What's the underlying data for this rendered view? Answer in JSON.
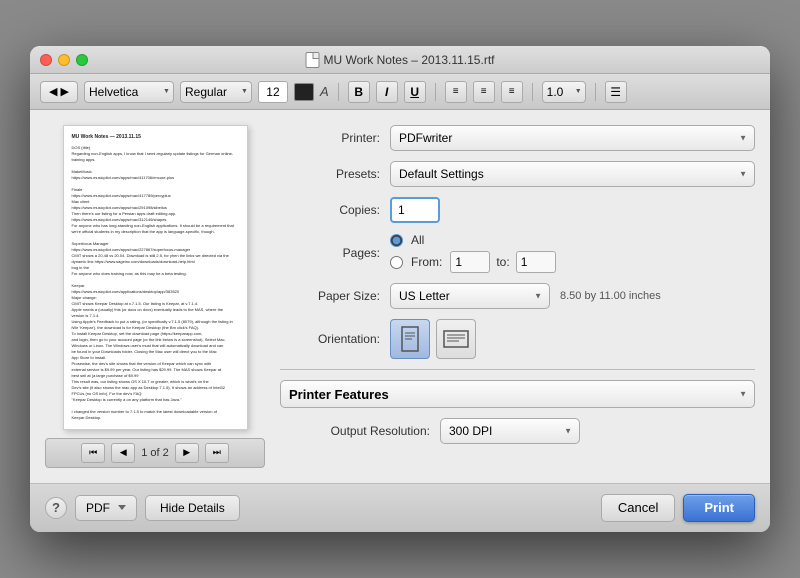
{
  "titlebar": {
    "title": "MU Work Notes – 2013.11.15.rtf"
  },
  "toolbar": {
    "format_btn_label": "▶|◀",
    "font_label": "Helvetica",
    "style_label": "Regular",
    "size_value": "12",
    "bold_label": "B",
    "italic_label": "I",
    "underline_label": "U",
    "align_left": "≡",
    "align_center": "≡",
    "align_right": "≡",
    "line_height": "1.0",
    "list_icon": "≡"
  },
  "printer": {
    "label": "Printer:",
    "value": "PDFwriter",
    "presets_label": "Presets:",
    "presets_value": "Default Settings",
    "copies_label": "Copies:",
    "copies_value": "1",
    "pages_label": "Pages:",
    "pages_all": "All",
    "pages_from": "From:",
    "pages_from_value": "1",
    "pages_to": "to:",
    "pages_to_value": "1",
    "paper_size_label": "Paper Size:",
    "paper_size_value": "US Letter",
    "paper_dims": "8.50 by 11.00 inches",
    "orientation_label": "Orientation:",
    "features_label": "Printer Features",
    "output_res_label": "Output Resolution:",
    "output_res_value": "300 DPI"
  },
  "preview": {
    "page_info": "1 of 2",
    "content_title": "MU Work Notes — 2013.11.15",
    "content_body": "DOS (title)\nRegarding non-English apps, I know that I semi-regularly update listings for German online-training apps.\n\nMakeMusic\nhttps://www.musicpilot.com/apps/mac/411706/encore-plus\n\nFinale\nhttps://www.musicpilot.com/apps/mac/417789/percyplus\nMac client\nhttps://www.musicpilot.com/apps/mac/291098/sibelius\nThen there's our listing for a Persian apps draft editing app.\nhttps://www.musicpilot.com/apps/mac/312146/shapes\nFor anyone who has long-standing non-English applications. It should be a requirement that we're official students in my description that the app is language-specific, though.\n\nSuperfocus Manager\nhttps://www.musicpilot.com/apps/mac/227867/superfocus-manager\nCMIT shows a 20.48 vs 20.04. Download is still 2.5, for yhen the links we directed via the dynamic link https://www.sageinc.com/downloads/download-help.html\nbug in the\nFor anyone who does training now, as this may be a beta testing.\n\nKeepar\nhttps://www.musicpilot.com/applications/desktop/app/383520\nMajor change:\nCMIT shows Keepar Desktop at v.7.1.5. Our listing is Keepar, at v.7.1.4.\nApple needs a (usually) this (or docs on docs) eventually leads to the MAS, where the\nversion is 7.1.4.\nUsing Apple's Feedback to put a rating, (or specifically v.7.1.5 (8079), although the listing in\niWe 'Keepar'), the download is for Keepar Desktop (the Bm click's FAQ).\nTo install Keepar Desktop, set the download page (https://keeparapp.com,\nand login, then go to your account page (or the link below is a screenshot), Select Mac.\nWindows or Linux. The Windows user's must that will automatically download and can\nbe found in your Downloads folder. Closing the Mac user will direct you to the Mac\nApp Store to install.\nProsewise, the dev's site shows that the version of Keepar which can sync with\nexternal service is $9.99 per year. Our listing has $29.99. The MAS shows Keepar at\nbest sell at (a large purchase of $9.99\nThis result was, our listing shows OS X 10.7 or greater, which is what's on the\nDev's site (it also shows the mac app as Desktop 7.1.5). It shows an address of Intel32\nFPCUs (no OS info). For the dev's FAQ:\n\"Keepar Desktop is currently a on any platform that has Java.\"\n\nI changed the version number to 7.1.5 to match the latest downloadable version of\nKeepar Desktop."
  },
  "bottom": {
    "help_label": "?",
    "pdf_label": "PDF",
    "hide_details_label": "Hide Details",
    "cancel_label": "Cancel",
    "print_label": "Print"
  }
}
